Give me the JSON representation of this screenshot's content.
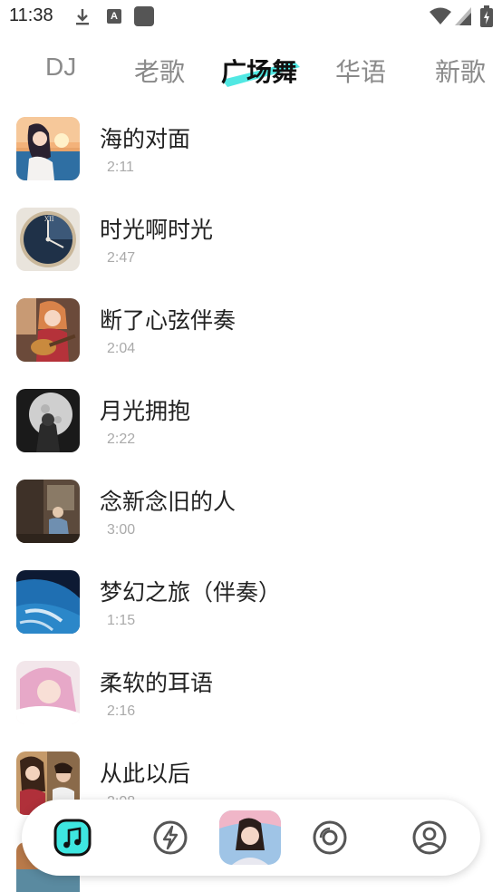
{
  "status_bar": {
    "time": "11:38",
    "icons": [
      "download-icon",
      "a-notification-icon",
      "app-square-icon",
      "wifi-icon",
      "signal-icon",
      "battery-icon"
    ]
  },
  "tabs": [
    {
      "label": "DJ",
      "selected": false
    },
    {
      "label": "老歌",
      "selected": false
    },
    {
      "label": "广场舞",
      "selected": true
    },
    {
      "label": "华语",
      "selected": false
    },
    {
      "label": "新歌",
      "selected": false
    }
  ],
  "accent_color": "#3ee6e0",
  "songs": [
    {
      "title": "海的对面",
      "duration": "2:11",
      "cover": "anime-girl-sunset-sea"
    },
    {
      "title": "时光啊时光",
      "duration": "2:47",
      "cover": "clock-face"
    },
    {
      "title": "断了心弦伴奏",
      "duration": "2:04",
      "cover": "anime-girl-guitar"
    },
    {
      "title": "月光拥抱",
      "duration": "2:22",
      "cover": "moonlight-figure"
    },
    {
      "title": "念新念旧的人",
      "duration": "3:00",
      "cover": "old-man-room"
    },
    {
      "title": "梦幻之旅（伴奏）",
      "duration": "1:15",
      "cover": "earth-from-space"
    },
    {
      "title": "柔软的耳语",
      "duration": "2:16",
      "cover": "anime-girl-pink-hair"
    },
    {
      "title": "从此以后",
      "duration": "2:08",
      "cover": "anime-couple"
    }
  ],
  "bottom_nav": [
    {
      "icon": "music-note-icon",
      "active": true
    },
    {
      "icon": "lightning-icon",
      "active": false
    },
    {
      "icon": "now-playing-cover",
      "active": false
    },
    {
      "icon": "disc-icon",
      "active": false
    },
    {
      "icon": "user-profile-icon",
      "active": false
    }
  ]
}
